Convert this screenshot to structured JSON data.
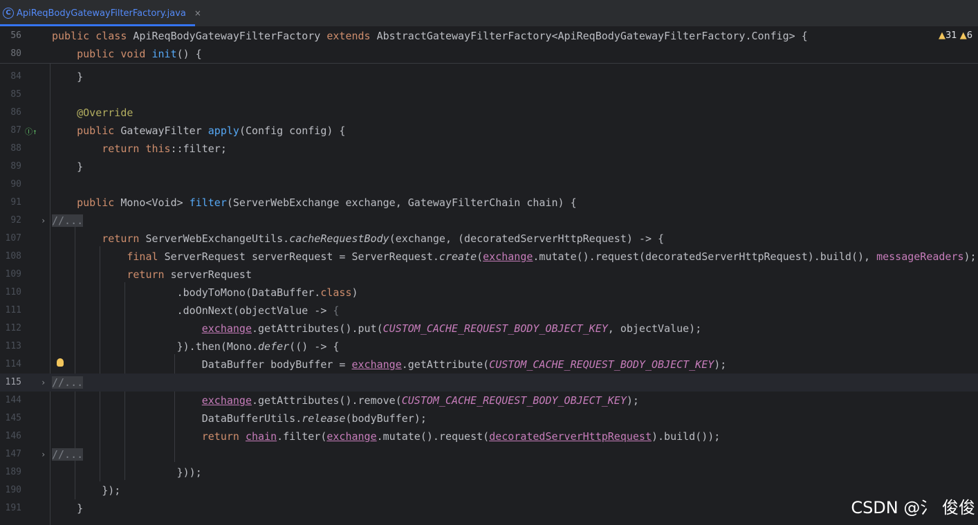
{
  "tab": {
    "icon": "class-icon",
    "label": "ApiReqBodyGatewayFilterFactory.java",
    "close": "×"
  },
  "inspections": {
    "warnings": "31",
    "weak_warnings": "6"
  },
  "sticky": [
    {
      "num": "56",
      "code": "public class ApiReqBodyGatewayFilterFactory extends AbstractGatewayFilterFactory<ApiReqBodyGatewayFilterFactory.Config> {"
    },
    {
      "num": "80",
      "code": "public void init() {"
    }
  ],
  "lines": [
    {
      "num": "84",
      "code": "}"
    },
    {
      "num": "85",
      "code": ""
    },
    {
      "num": "86",
      "code": "@Override"
    },
    {
      "num": "87",
      "code": "public GatewayFilter apply(Config config) {"
    },
    {
      "num": "88",
      "code": "return this::filter;"
    },
    {
      "num": "89",
      "code": "}"
    },
    {
      "num": "90",
      "code": ""
    },
    {
      "num": "91",
      "code": "public Mono<Void> filter(ServerWebExchange exchange, GatewayFilterChain chain) {"
    },
    {
      "num": "92",
      "code": "//..."
    },
    {
      "num": "107",
      "code": "return ServerWebExchangeUtils.cacheRequestBody(exchange, (decoratedServerHttpRequest) -> {"
    },
    {
      "num": "108",
      "code": "final ServerRequest serverRequest = ServerRequest.create(exchange.mutate().request(decoratedServerHttpRequest).build(), messageReaders);"
    },
    {
      "num": "109",
      "code": "return serverRequest"
    },
    {
      "num": "110",
      "code": ".bodyToMono(DataBuffer.class)"
    },
    {
      "num": "111",
      "code": ".doOnNext(objectValue -> {"
    },
    {
      "num": "112",
      "code": "exchange.getAttributes().put(CUSTOM_CACHE_REQUEST_BODY_OBJECT_KEY, objectValue);"
    },
    {
      "num": "113",
      "code": "}).then(Mono.defer(() -> {"
    },
    {
      "num": "114",
      "code": "DataBuffer bodyBuffer = exchange.getAttribute(CUSTOM_CACHE_REQUEST_BODY_OBJECT_KEY);"
    },
    {
      "num": "115",
      "code": "//..."
    },
    {
      "num": "144",
      "code": "exchange.getAttributes().remove(CUSTOM_CACHE_REQUEST_BODY_OBJECT_KEY);"
    },
    {
      "num": "145",
      "code": "DataBufferUtils.release(bodyBuffer);"
    },
    {
      "num": "146",
      "code": "return chain.filter(exchange.mutate().request(decoratedServerHttpRequest).build());"
    },
    {
      "num": "147",
      "code": "//..."
    },
    {
      "num": "189",
      "code": "}));"
    },
    {
      "num": "190",
      "code": "});"
    },
    {
      "num": "191",
      "code": "}"
    }
  ],
  "watermark": "CSDN @氵 俊俊",
  "colors": {
    "background": "#1e1f22",
    "keyword": "#cf8e6d",
    "function": "#56a8f5",
    "constant": "#c77dbb",
    "annotation": "#b3ae60",
    "text": "#bcbec4",
    "accent": "#3574f0"
  }
}
